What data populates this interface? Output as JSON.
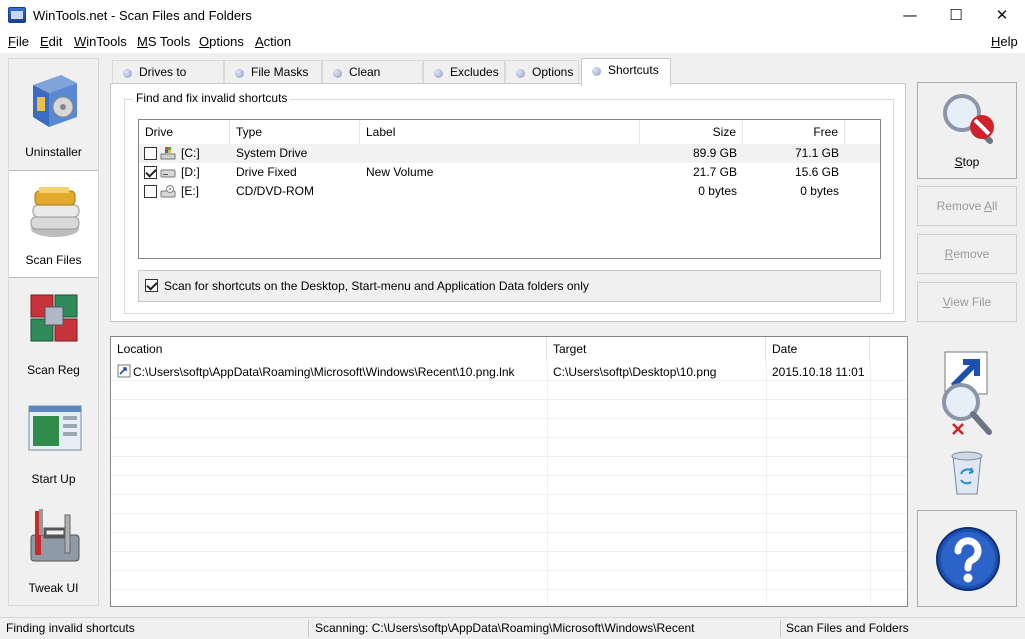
{
  "window": {
    "title": "WinTools.net - Scan Files and Folders",
    "controls": {
      "minimize": "—",
      "maximize": "☐",
      "close": "✕"
    }
  },
  "menu": {
    "items": [
      {
        "first": "F",
        "rest": "ile"
      },
      {
        "first": "E",
        "rest": "dit"
      },
      {
        "first": "W",
        "rest": "inTools"
      },
      {
        "first": "M",
        "rest": "S Tools"
      },
      {
        "first": "O",
        "rest": "ptions"
      },
      {
        "first": "A",
        "rest": "ction"
      }
    ],
    "help": {
      "first": "H",
      "rest": "elp"
    }
  },
  "sidebar": {
    "items": [
      {
        "label": "Uninstaller",
        "icon": "box-icon"
      },
      {
        "label": "Scan Files",
        "icon": "stack-icon",
        "active": true
      },
      {
        "label": "Scan Reg",
        "icon": "cubes-icon"
      },
      {
        "label": "Start Up",
        "icon": "window-icon"
      },
      {
        "label": "Tweak UI",
        "icon": "toolbox-icon"
      }
    ]
  },
  "tabs": [
    "Drives to Scan",
    "File Masks",
    "Clean Folders",
    "Excludes",
    "Options",
    "Shortcuts"
  ],
  "active_tab": "Shortcuts",
  "shortcuts": {
    "group_title": "Find and fix invalid shortcuts",
    "columns": {
      "drive": "Drive",
      "type": "Type",
      "label": "Label",
      "size": "Size",
      "free": "Free"
    },
    "drives": [
      {
        "drive": "[C:]",
        "type": "System Drive",
        "label": "",
        "size": "89.9 GB",
        "free": "71.1 GB",
        "checked": false
      },
      {
        "drive": "[D:]",
        "type": "Drive Fixed",
        "label": "New Volume",
        "size": "21.7 GB",
        "free": "15.6 GB",
        "checked": true
      },
      {
        "drive": "[E:]",
        "type": "CD/DVD-ROM",
        "label": "",
        "size": "0 bytes",
        "free": "0 bytes",
        "checked": false
      }
    ],
    "scan_option": "Scan for shortcuts on the Desktop, Start-menu and Application Data folders only",
    "scan_option_checked": true
  },
  "results": {
    "columns": {
      "location": "Location",
      "target": "Target",
      "date": "Date"
    },
    "rows": [
      {
        "location": "C:\\Users\\softp\\AppData\\Roaming\\Microsoft\\Windows\\Recent\\10.png.lnk",
        "target": "C:\\Users\\softp\\Desktop\\10.png",
        "date": "2015.10.18 11:01"
      }
    ]
  },
  "buttons": {
    "stop": {
      "first": "S",
      "rest": "top"
    },
    "remove_all": {
      "pre": "Remove ",
      "first": "A",
      "rest": "ll"
    },
    "remove": {
      "pre": "",
      "first": "R",
      "rest": "emove"
    },
    "view_file": {
      "pre": "",
      "first": "V",
      "rest": "iew File"
    }
  },
  "status": {
    "left": "Finding invalid shortcuts",
    "middle": "Scanning: C:\\Users\\softp\\AppData\\Roaming\\Microsoft\\Windows\\Recent",
    "right": "Scan Files and Folders"
  },
  "colors": {
    "accent": "#2b5fb8",
    "stop_red": "#d0202a",
    "help_blue": "#1d4fb0"
  }
}
